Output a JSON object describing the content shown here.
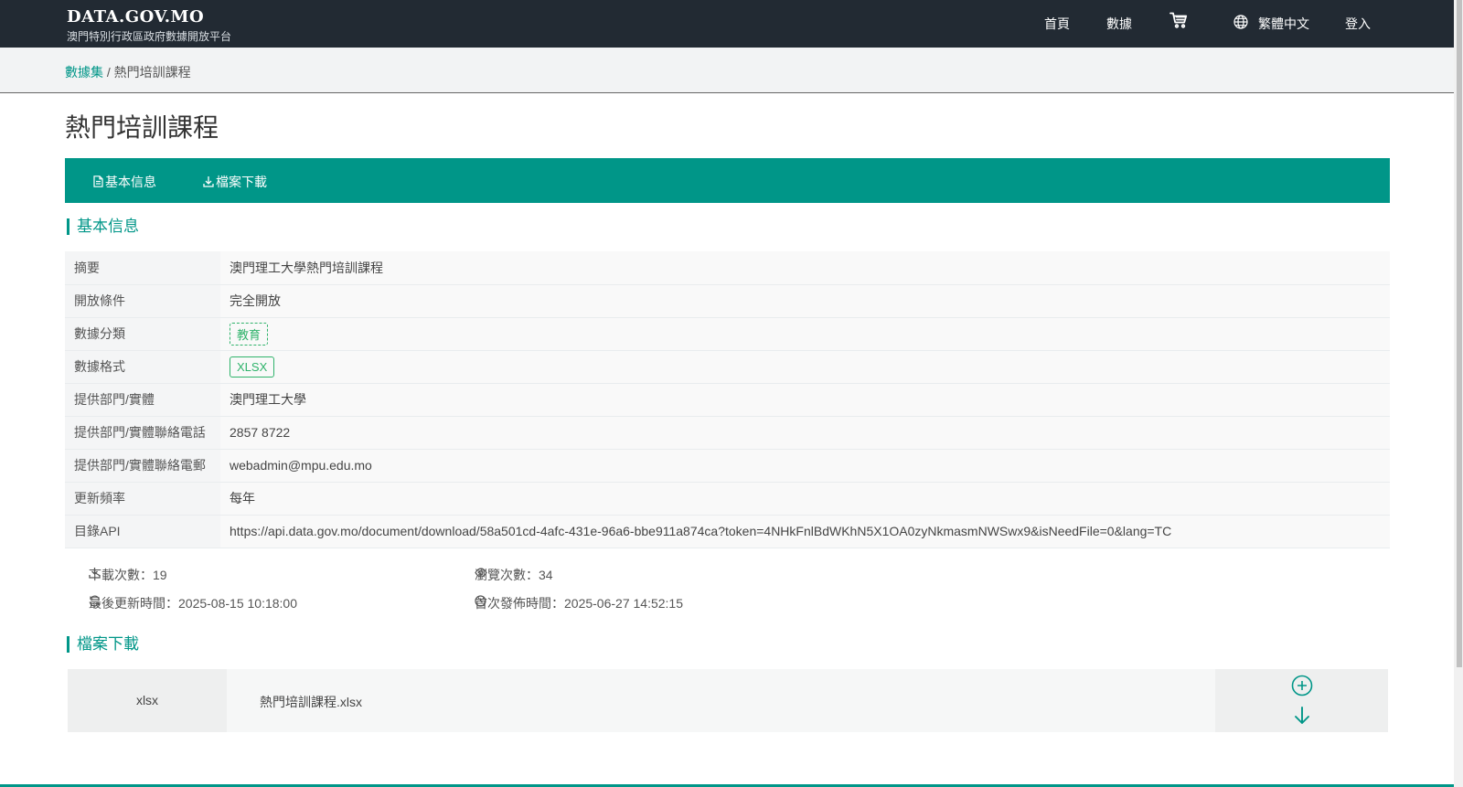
{
  "header": {
    "logo_title": "DATA.GOV.MO",
    "logo_subtitle": "澳門特別行政區政府數據開放平台",
    "nav": {
      "home": "首頁",
      "data": "數據",
      "language": "繁體中文",
      "login": "登入"
    }
  },
  "breadcrumb": {
    "root": "數據集",
    "separator": " / ",
    "current": "熱門培訓課程"
  },
  "page_title": "熱門培訓課程",
  "tabs": {
    "basic_info": "基本信息",
    "file_download": "檔案下載"
  },
  "basic_info": {
    "section_title": "基本信息",
    "rows": [
      {
        "key": "摘要",
        "value": "澳門理工大學熱門培訓課程"
      },
      {
        "key": "開放條件",
        "value": "完全開放"
      },
      {
        "key": "數據分類",
        "value": "教育"
      },
      {
        "key": "數據格式",
        "value": "XLSX"
      },
      {
        "key": "提供部門/實體",
        "value": "澳門理工大學"
      },
      {
        "key": "提供部門/實體聯絡電話",
        "value": "2857 8722"
      },
      {
        "key": "提供部門/實體聯絡電郵",
        "value": "webadmin@mpu.edu.mo"
      },
      {
        "key": "更新頻率",
        "value": "每年"
      },
      {
        "key": "目錄API",
        "value": "https://api.data.gov.mo/document/download/58a501cd-4afc-431e-96a6-bbe911a874ca?token=4NHkFnlBdWKhN5X1OA0zyNkmasmNWSwx9&isNeedFile=0&lang=TC"
      }
    ]
  },
  "stats": {
    "downloads": "下載次數：19",
    "views": "瀏覽次數：34",
    "last_updated": "最後更新時間：2025-08-15 10:18:00",
    "first_published": "首次發佈時間：2025-06-27 14:52:15"
  },
  "files": {
    "section_title": "檔案下載",
    "items": [
      {
        "type": "xlsx",
        "name": "熱門培訓課程.xlsx"
      }
    ]
  },
  "colors": {
    "topbar": "#222a33",
    "accent": "#009688",
    "tag_green": "#2fb36b"
  }
}
